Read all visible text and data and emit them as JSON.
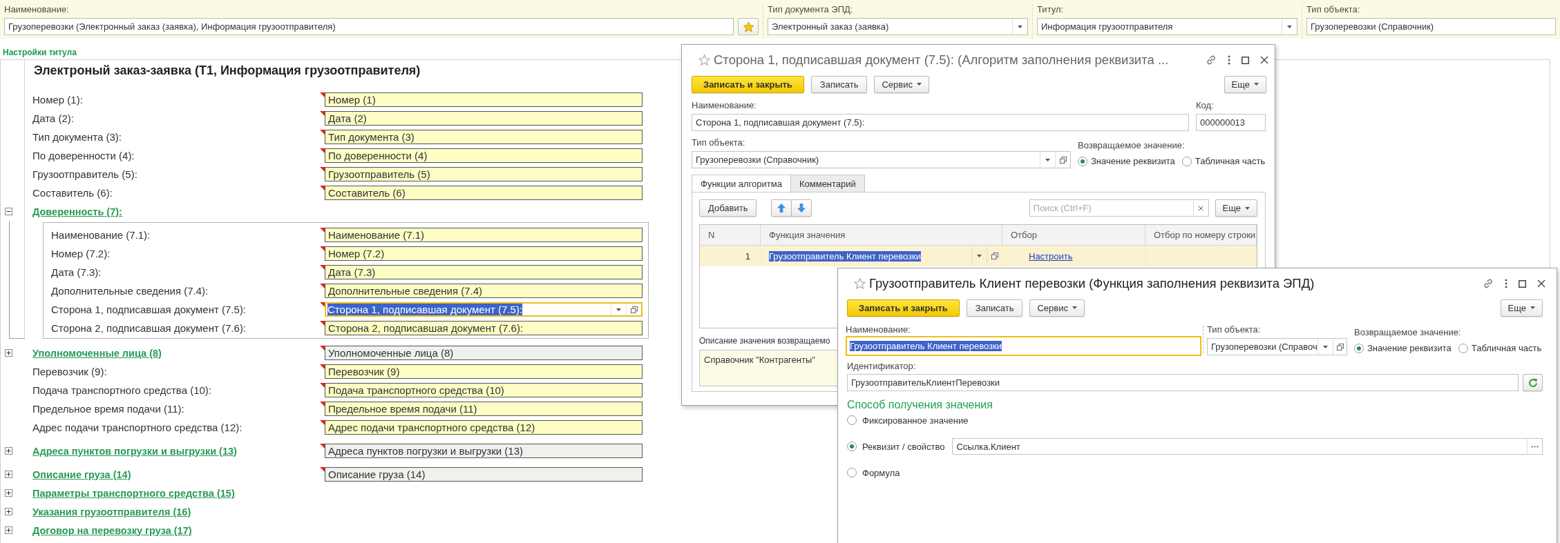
{
  "header": {
    "fields": [
      {
        "kind": "favorite",
        "label": "Наименование:",
        "value": "Грузоперевозки (Электронный заказ (заявка), Информация грузоотправителя)"
      },
      {
        "kind": "select",
        "label": "Тип документа ЭПД:",
        "value": "Электронный заказ (заявка)"
      },
      {
        "kind": "select",
        "label": "Титул:",
        "value": "Информация грузоотправителя"
      },
      {
        "kind": "text",
        "label": "Тип объекта:",
        "value": "Грузоперевозки (Справочник)"
      }
    ]
  },
  "section_title": "Настройки титула",
  "form": {
    "title": "Электроный заказ-заявка (Т1, Информация грузоотправителя)",
    "items": [
      {
        "kind": "field",
        "label": "Номер (1):",
        "value": "Номер (1)",
        "selected": false
      },
      {
        "kind": "field",
        "label": "Дата (2):",
        "value": "Дата (2)",
        "selected": false
      },
      {
        "kind": "field",
        "label": "Тип документа (3):",
        "value": "Тип документа (3)",
        "selected": false
      },
      {
        "kind": "field",
        "label": "По доверенности (4):",
        "value": "По доверенности (4)",
        "selected": false
      },
      {
        "kind": "field",
        "label": "Грузоотправитель (5):",
        "value": "Грузоотправитель (5)",
        "selected": false
      },
      {
        "kind": "field",
        "label": "Составитель (6):",
        "value": "Составитель (6)",
        "selected": false
      },
      {
        "kind": "group",
        "label": "Доверенность (7):",
        "expanded": true,
        "children": [
          {
            "kind": "field",
            "label": "Наименование (7.1):",
            "value": "Наименование (7.1)",
            "selected": false
          },
          {
            "kind": "field",
            "label": "Номер (7.2):",
            "value": "Номер (7.2)",
            "selected": false
          },
          {
            "kind": "field",
            "label": "Дата (7.3):",
            "value": "Дата (7.3)",
            "selected": false
          },
          {
            "kind": "field",
            "label": "Дополнительные сведения (7.4):",
            "value": "Дополнительные сведения (7.4)",
            "selected": false
          },
          {
            "kind": "field",
            "label": "Сторона 1, подписавшая документ (7.5):",
            "value": "Сторона 1, подписавшая документ (7.5):",
            "selected": true
          },
          {
            "kind": "field",
            "label": "Сторона 2, подписавшая документ (7.6):",
            "value": "Сторона 2, подписавшая документ (7.6):",
            "selected": false
          }
        ]
      },
      {
        "kind": "group",
        "label": "Уполномоченные лица (8)",
        "expanded": false,
        "value": "Уполномоченные лица (8)"
      },
      {
        "kind": "field",
        "label": "Перевозчик (9):",
        "value": "Перевозчик (9)",
        "selected": false
      },
      {
        "kind": "field",
        "label": "Подача транспортного средства (10):",
        "value": "Подача транспортного средства (10)",
        "selected": false
      },
      {
        "kind": "field",
        "label": "Предельное время подачи (11):",
        "value": "Предельное время подачи (11)",
        "selected": false
      },
      {
        "kind": "field",
        "label": "Адрес подачи транспортного средства (12):",
        "value": "Адрес подачи транспортного средства (12)",
        "selected": false
      },
      {
        "kind": "group",
        "label": "Адреса пунктов погрузки и выгрузки (13)",
        "expanded": false,
        "value": "Адреса пунктов погрузки и выгрузки (13)"
      },
      {
        "kind": "group",
        "label": "Описание груза (14)",
        "expanded": false,
        "value": "Описание груза (14)"
      },
      {
        "kind": "group",
        "label": "Параметры транспортного средства (15)",
        "expanded": false
      },
      {
        "kind": "group",
        "label": "Указания грузоотправителя (16)",
        "expanded": false
      },
      {
        "kind": "group",
        "label": "Договор на перевозку груза (17)",
        "expanded": false
      }
    ]
  },
  "algorithm_window": {
    "active": false,
    "title": "Сторона 1, подписавшая документ (7.5): (Алгоритм заполнения реквизита ...",
    "toolbar": [
      {
        "kind": "primary",
        "label": "Записать и закрыть"
      },
      {
        "kind": "plain",
        "label": "Записать"
      },
      {
        "kind": "menu",
        "label": "Сервис"
      }
    ],
    "more_button": "Еще",
    "name": {
      "label": "Наименование:",
      "value": "Сторона 1, подписавшая документ (7.5):",
      "focused": false
    },
    "code": {
      "label": "Код:",
      "value": "000000013"
    },
    "object_type": {
      "label": "Тип объекта:",
      "value": "Грузоперевозки (Справочник)"
    },
    "return_value": {
      "label": "Возвращаемое значение:",
      "options": [
        {
          "label": "Значение реквизита",
          "selected": true
        },
        {
          "label": "Табличная часть",
          "selected": false
        }
      ]
    },
    "tabs": [
      {
        "label": "Функции алгоритма",
        "selected": true
      },
      {
        "label": "Комментарий",
        "selected": false
      }
    ],
    "table_toolbar": {
      "add_button": "Добавить",
      "search": {
        "placeholder": "Поиск (Ctrl+F)"
      },
      "more_button": "Еще"
    },
    "table": {
      "columns": [
        "N",
        "Функция значения",
        "Отбор",
        "Отбор по номеру строки"
      ],
      "rows": [
        {
          "n": "1",
          "function": "Грузоотправитель Клиент перевозки",
          "filter": "Настроить",
          "selected": true
        }
      ]
    },
    "description": {
      "label": "Описание значения возвращаемо",
      "value": "Справочник \"Контрагенты\""
    }
  },
  "function_window": {
    "active": true,
    "title": "Грузоотправитель Клиент перевозки (Функция заполнения реквизита ЭПД)",
    "toolbar": [
      {
        "kind": "primary",
        "label": "Записать и закрыть"
      },
      {
        "kind": "plain",
        "label": "Записать"
      },
      {
        "kind": "menu",
        "label": "Сервис"
      }
    ],
    "more_button": "Еще",
    "name": {
      "label": "Наименование:",
      "value": "Грузоотправитель Клиент перевозки",
      "focused": true
    },
    "object_type": {
      "label": "Тип объекта:",
      "value": "Грузоперевозки (Справоч"
    },
    "return_value": {
      "label": "Возвращаемое значение:",
      "options": [
        {
          "label": "Значение реквизита",
          "selected": true
        },
        {
          "label": "Табличная часть",
          "selected": false
        }
      ]
    },
    "identifier": {
      "label": "Идентификатор:",
      "value": "ГрузоотправительКлиентПеревозки"
    },
    "method": {
      "title": "Способ получения значения",
      "options": [
        {
          "kind": "plain",
          "label": "Фиксированное значение",
          "selected": false
        },
        {
          "kind": "field",
          "label": "Реквизит / свойство",
          "selected": true,
          "value": "Ссылка.Клиент"
        },
        {
          "kind": "plain",
          "label": "Формула",
          "selected": false
        }
      ]
    }
  }
}
